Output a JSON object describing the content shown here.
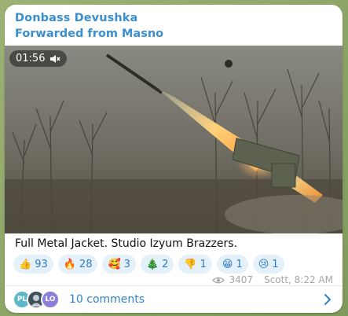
{
  "message": {
    "author": "Donbass Devushka",
    "forwarded_from": "Forwarded from Masno",
    "video": {
      "duration": "01:56",
      "muted": true
    },
    "caption": "Full Metal Jacket. Studio Izyum Brazzers.",
    "reactions": [
      {
        "emoji": "👍",
        "count": "93"
      },
      {
        "emoji": "🔥",
        "count": "28"
      },
      {
        "emoji": "🥰",
        "count": "3"
      },
      {
        "emoji": "🎄",
        "count": "2"
      },
      {
        "emoji": "👎",
        "count": "1"
      },
      {
        "emoji": "😁",
        "count": "1"
      },
      {
        "emoji": "😢",
        "count": "1"
      }
    ],
    "views": "3407",
    "signature_time": "Scott, 8:22 AM",
    "comments": {
      "label": "10 comments",
      "avatars": [
        {
          "initials": "PL",
          "color": "#5fb8c9"
        },
        {
          "initials": "",
          "color": "#3e4e5a"
        },
        {
          "initials": "LO",
          "color": "#8a7fd8"
        }
      ]
    }
  },
  "colors": {
    "link": "#3a8fd0",
    "reaction_bg": "#e4f1fb",
    "chat_bg": "#8fa86a"
  }
}
